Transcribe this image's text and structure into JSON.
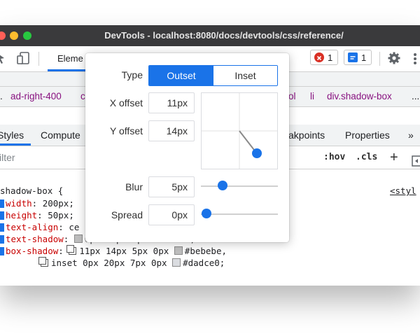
{
  "window": {
    "title": "DevTools - localhost:8080/docs/devtools/css/reference/",
    "traffic_colors": [
      "#ff5f57",
      "#febc2e",
      "#28c840"
    ]
  },
  "toolbar": {
    "tab_elements": "Eleme",
    "error_count": "1",
    "message_count": "1"
  },
  "breadcrumbs": [
    ".",
    "ad-right-400",
    "c",
    "ol",
    "li",
    "div.shadow-box",
    "..."
  ],
  "styles_tabs": {
    "styles": "Styles",
    "computed": "Compute",
    "breakpoints": "akpoints",
    "properties": "Properties",
    "more": "»"
  },
  "filter": {
    "placeholder": "ilter",
    "hov": ":hov",
    "cls": ".cls",
    "add": "+"
  },
  "rule": {
    "selector": "shadow-box {",
    "source_link": "<styl",
    "declarations": [
      {
        "prop": "width",
        "value": " 200px;"
      },
      {
        "prop": "height",
        "value": " 50px;"
      },
      {
        "prop": "text-align",
        "value": " ce"
      },
      {
        "prop": "text-shadow",
        "value": "0px 20px 1px #bebebe;"
      },
      {
        "prop": "box-shadow",
        "value_a": "11px 14px 5px 0px",
        "color_a": "#bebebe,"
      },
      {
        "value_b": "inset 0px 20px 7px 0px",
        "color_b": "#dadce0;"
      }
    ]
  },
  "shadow_editor": {
    "type_label": "Type",
    "outset_label": "Outset",
    "inset_label": "Inset",
    "x_label": "X offset",
    "x_value": "11px",
    "y_label": "Y offset",
    "y_value": "14px",
    "blur_label": "Blur",
    "blur_value": "5px",
    "spread_label": "Spread",
    "spread_value": "0px",
    "accent_color": "#1a73e8"
  }
}
